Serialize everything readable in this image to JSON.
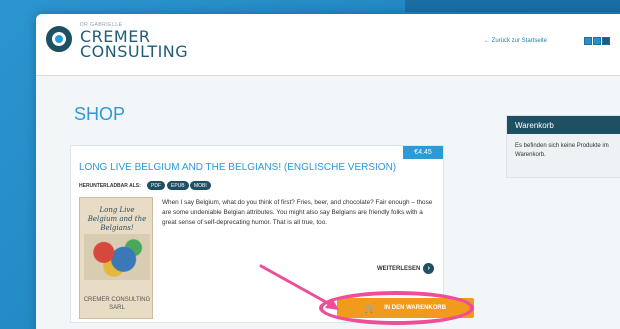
{
  "header": {
    "logo_small": "DR GABRIELLE",
    "logo_line1": "CREMER",
    "logo_line2": "CONSULTING",
    "back_link": "← Zurück zur Startseite",
    "languages": [
      "EN",
      "DE",
      "FR"
    ]
  },
  "main": {
    "title": "SHOP"
  },
  "product": {
    "price": "€4.45",
    "title": "LONG LIVE BELGIUM AND THE BELGIANS! (ENGLISCHE VERSION)",
    "download_label": "HERUNTERLADBAR ALS:",
    "formats": [
      "PDF",
      "EPUB",
      "MOBI"
    ],
    "cover_title": "Long Live Belgium and the Belgians!",
    "cover_author": "CREMER CONSULTING SARL",
    "description": "When I say Belgium, what do you think of first? Fries, beer, and chocolate? Fair enough – those are some undeniable Belgian attributes. You might also say Belgians are friendly folks with a great sense of self-deprecating humor. That is all true, too.",
    "read_more": "WEITERLESEN",
    "add_to_cart": "IN DEN WARENKORB"
  },
  "cart": {
    "title": "Warenkorb",
    "empty_message": "Es befinden sich keine Produkte im Warenkorb."
  },
  "colors": {
    "accent": "#2b9ad6",
    "dark": "#1f4f63",
    "cart_button": "#f29a1c",
    "highlight": "#ef4d97"
  }
}
